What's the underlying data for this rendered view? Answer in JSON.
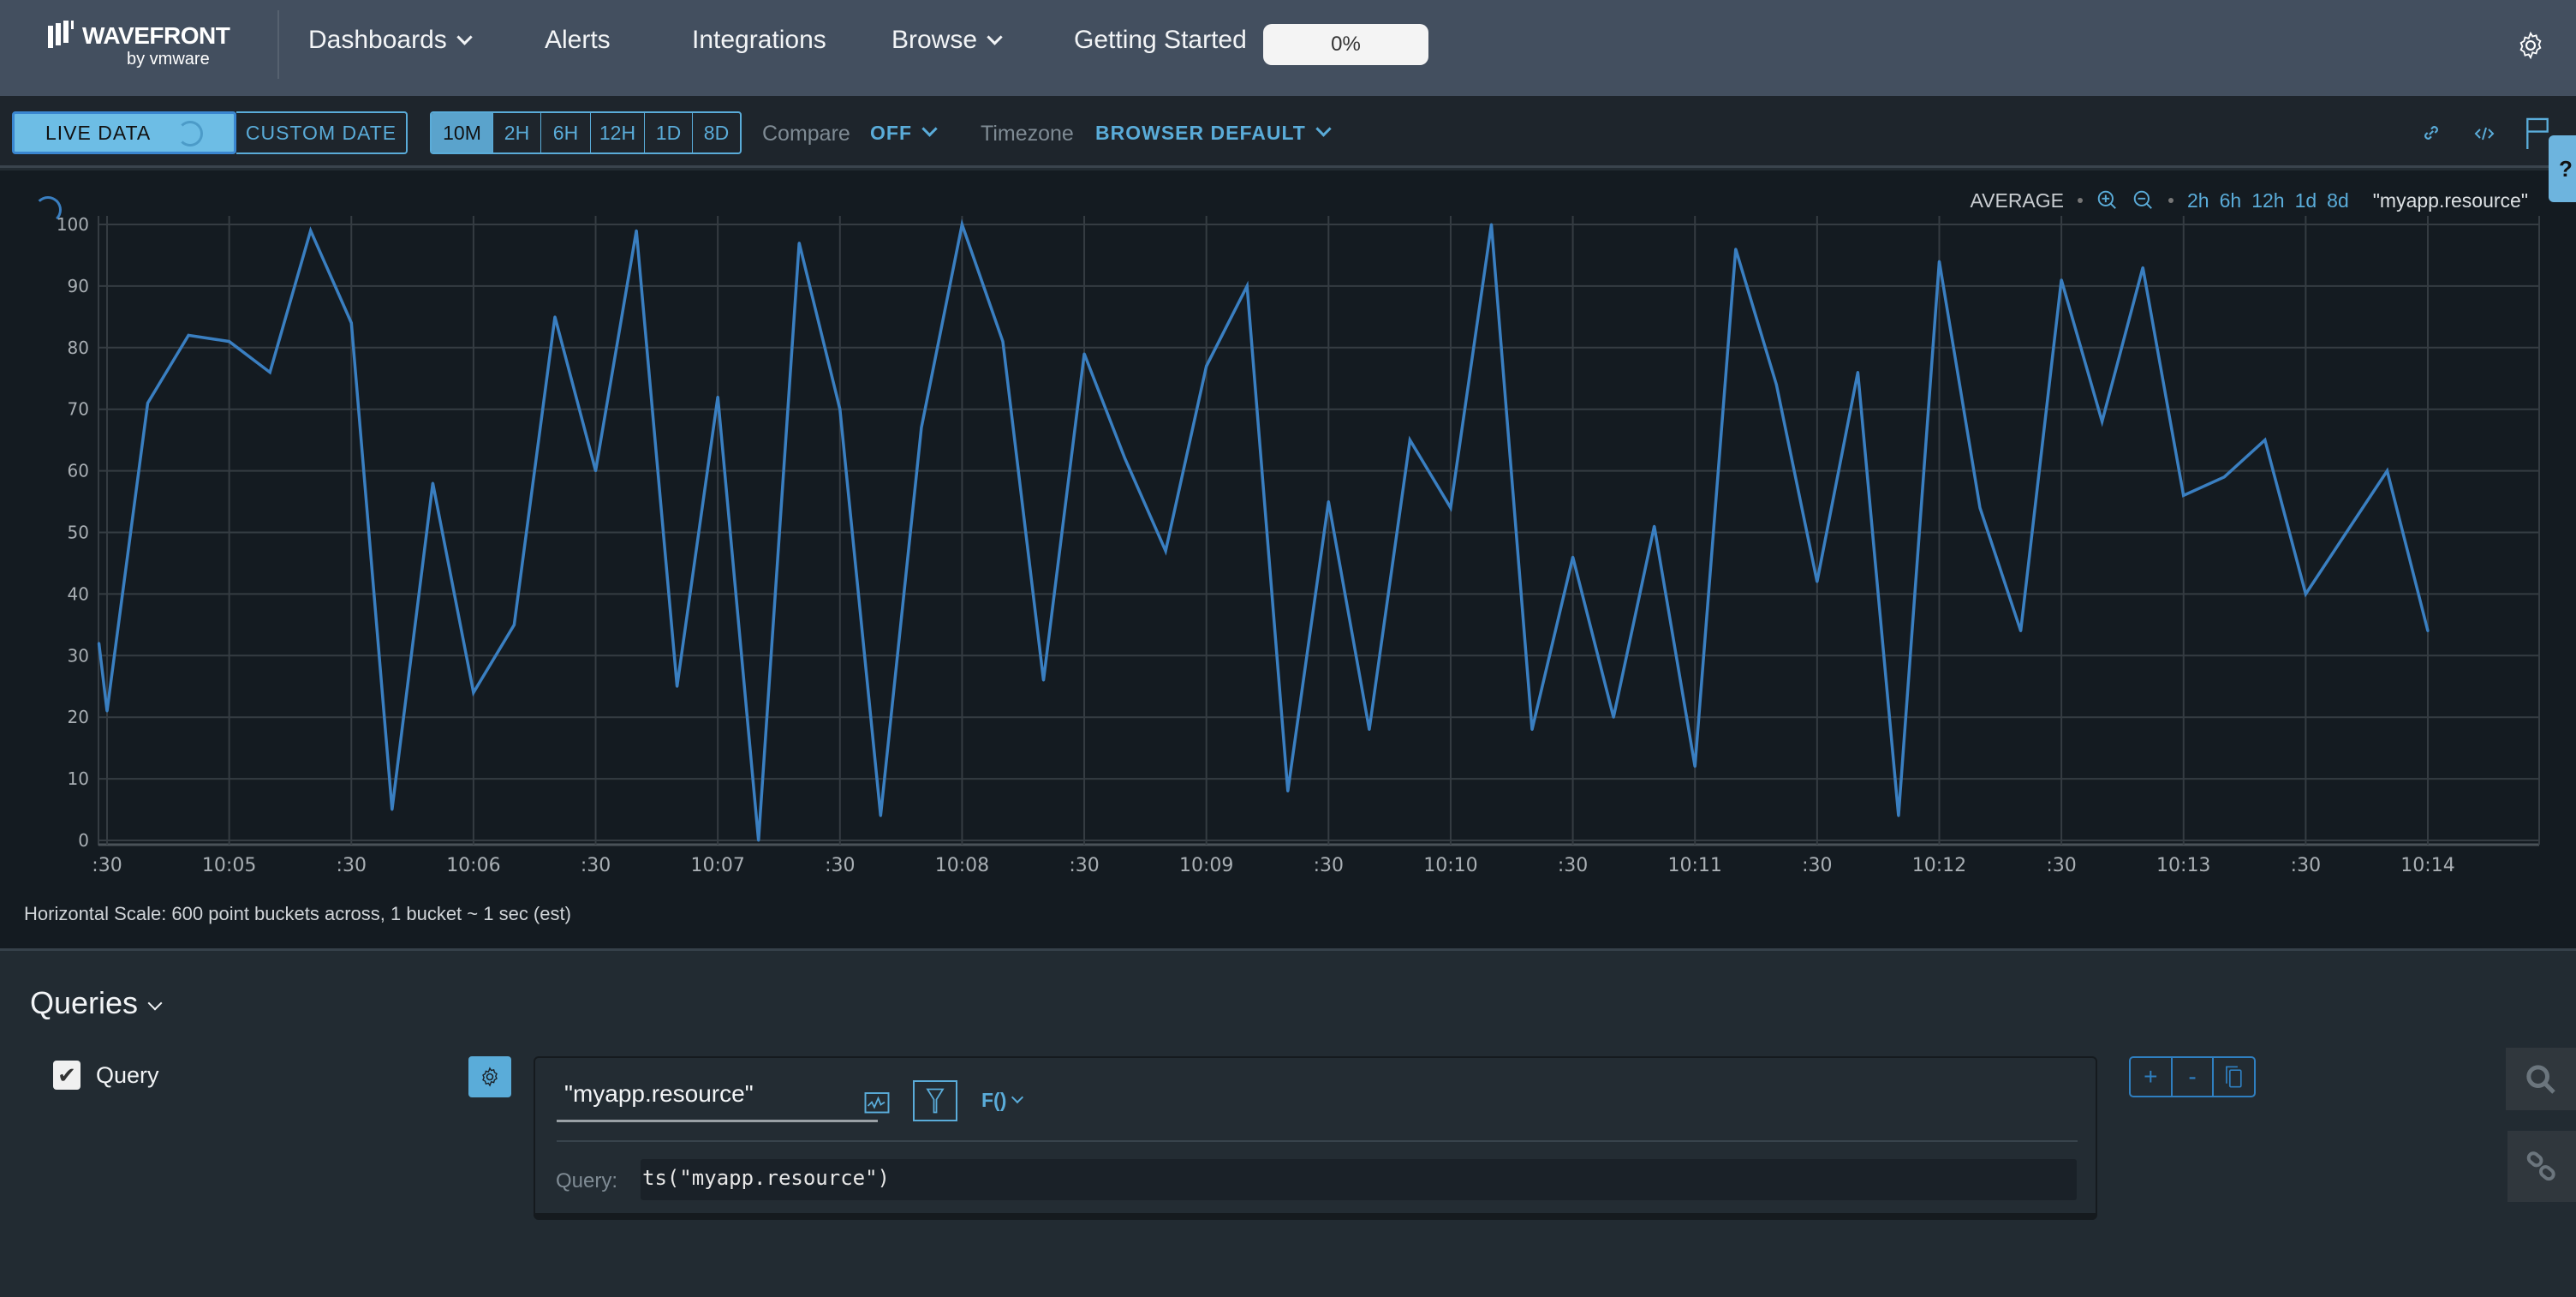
{
  "header": {
    "logo_text": "WAVEFRONT",
    "logo_sub": "by vmware",
    "nav": [
      {
        "label": "Dashboards",
        "dropdown": true
      },
      {
        "label": "Alerts",
        "dropdown": false
      },
      {
        "label": "Integrations",
        "dropdown": false
      },
      {
        "label": "Browse",
        "dropdown": true
      },
      {
        "label": "Getting Started",
        "dropdown": false
      }
    ],
    "getting_started_progress": "0%",
    "settings_icon": "gear-icon"
  },
  "toolbar": {
    "live_data": "LIVE DATA",
    "custom_date": "CUSTOM DATE",
    "ranges": [
      "10M",
      "2H",
      "6H",
      "12H",
      "1D",
      "8D"
    ],
    "active_range": "10M",
    "compare_label": "Compare",
    "compare_value": "OFF",
    "timezone_label": "Timezone",
    "timezone_value": "BROWSER DEFAULT",
    "icons": [
      "link-icon",
      "embed-code-icon",
      "flag-icon"
    ],
    "help": "?"
  },
  "chart_header": {
    "summarization": "AVERAGE",
    "zoom_ranges": [
      "2h",
      "6h",
      "12h",
      "1d",
      "8d"
    ],
    "legend": "\"myapp.resource\""
  },
  "chart_data": {
    "type": "line",
    "title": "",
    "xlabel": "",
    "ylabel": "",
    "ylim": [
      0,
      100
    ],
    "grid": true,
    "y_ticks": [
      0,
      10,
      20,
      30,
      40,
      50,
      60,
      70,
      80,
      90,
      100
    ],
    "x_ticks": [
      ":30",
      "10:05",
      ":30",
      "10:06",
      ":30",
      "10:07",
      ":30",
      "10:08",
      ":30",
      "10:09",
      ":30",
      "10:10",
      ":30",
      "10:11",
      ":30",
      "10:12",
      ":30",
      "10:13",
      ":30",
      "10:14"
    ],
    "color": "#3a7fc1",
    "series": [
      {
        "name": "\"myapp.resource\"",
        "x": [
          "10:04:28",
          "10:04:30",
          "10:04:40",
          "10:04:50",
          "10:05:00",
          "10:05:10",
          "10:05:20",
          "10:05:30",
          "10:05:40",
          "10:05:50",
          "10:06:00",
          "10:06:10",
          "10:06:20",
          "10:06:30",
          "10:06:40",
          "10:06:50",
          "10:07:00",
          "10:07:10",
          "10:07:20",
          "10:07:30",
          "10:07:40",
          "10:07:50",
          "10:08:00",
          "10:08:10",
          "10:08:20",
          "10:08:30",
          "10:08:40",
          "10:08:50",
          "10:09:00",
          "10:09:10",
          "10:09:20",
          "10:09:30",
          "10:09:40",
          "10:09:50",
          "10:10:00",
          "10:10:10",
          "10:10:20",
          "10:10:30",
          "10:10:40",
          "10:10:50",
          "10:11:00",
          "10:11:10",
          "10:11:20",
          "10:11:30",
          "10:11:40",
          "10:11:50",
          "10:12:00",
          "10:12:10",
          "10:12:20",
          "10:12:30",
          "10:12:40",
          "10:12:50",
          "10:13:00",
          "10:13:10",
          "10:13:20",
          "10:13:30",
          "10:13:40",
          "10:13:50",
          "10:14:00"
        ],
        "values": [
          32,
          21,
          71,
          82,
          81,
          76,
          99,
          84,
          5,
          58,
          24,
          35,
          85,
          60,
          99,
          25,
          72,
          0,
          97,
          70,
          4,
          67,
          100,
          81,
          26,
          79,
          62,
          47,
          77,
          90,
          8,
          55,
          18,
          65,
          54,
          100,
          18,
          46,
          20,
          51,
          12,
          96,
          74,
          42,
          76,
          4,
          94,
          54,
          34,
          91,
          68,
          93,
          56,
          59,
          65,
          40,
          50,
          60,
          34
        ]
      }
    ]
  },
  "footer_note": "Horizontal Scale: 600 point buckets across, 1 bucket ~ 1 sec (est)",
  "queries": {
    "title": "Queries",
    "query_name": "Query",
    "query_enabled": true,
    "metric_input": "\"myapp.resource\"",
    "function_label": "F()",
    "query_label": "Query:",
    "query_text": "ts(\"myapp.resource\")",
    "actions": [
      "+",
      "-",
      "copy"
    ]
  },
  "colors": {
    "accent": "#5aacd9",
    "header": "#434f5f",
    "series": "#3a7fc1"
  }
}
